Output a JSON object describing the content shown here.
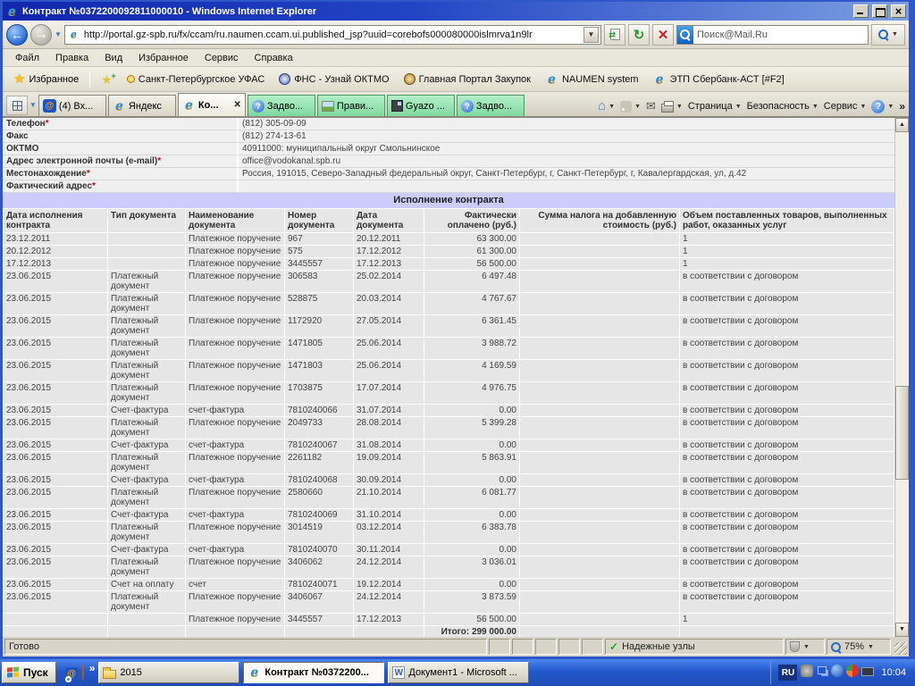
{
  "window": {
    "title": "Контракт №0372200092811000010 - Windows Internet Explorer"
  },
  "address_bar": {
    "url": "http://portal.gz-spb.ru/fx/ccam/ru.naumen.ccam.ui.published_jsp?uuid=corebofs000080000islmrva1n9lr",
    "search_text": "Поиск@Mail.Ru"
  },
  "menu_bar": {
    "items": [
      "Файл",
      "Правка",
      "Вид",
      "Избранное",
      "Сервис",
      "Справка"
    ]
  },
  "favorites_bar": {
    "favorites_label": "Избранное",
    "links": [
      {
        "label": "Санкт-Петербургское УФАС",
        "icon": "lamp-icon"
      },
      {
        "label": "ФНС - Узнай ОКТМО",
        "icon": "fns-emblem-icon"
      },
      {
        "label": "Главная Портал Закупок",
        "icon": "eagle-emblem-icon"
      },
      {
        "label": "NAUMEN system",
        "icon": "ie-icon"
      },
      {
        "label": "ЭТП Сбербанк-АСТ [#F2]",
        "icon": "ie-icon"
      }
    ]
  },
  "tab_bar": {
    "tabs": [
      {
        "label": "(4) Вх...",
        "icon": "mailru-icon",
        "style": "normal",
        "closable": false
      },
      {
        "label": "Яндекс",
        "icon": "ie-icon",
        "style": "normal",
        "closable": false
      },
      {
        "label": "Ко...",
        "icon": "ie-icon",
        "style": "active",
        "closable": true
      },
      {
        "label": "Задво...",
        "icon": "question-icon",
        "style": "green",
        "closable": false
      },
      {
        "label": "Прави...",
        "icon": "picture-icon",
        "style": "green",
        "closable": false
      },
      {
        "label": "Gyazo ...",
        "icon": "gyazo-icon",
        "style": "green",
        "closable": false
      },
      {
        "label": "Задво...",
        "icon": "question-icon",
        "style": "green",
        "closable": false
      }
    ],
    "commands": [
      "Страница",
      "Безопасность",
      "Сервис"
    ]
  },
  "page": {
    "form_rows": [
      {
        "label": "Телефон",
        "required": true,
        "value": "(812) 305-09-09"
      },
      {
        "label": "Факс",
        "required": false,
        "value": "(812) 274-13-61"
      },
      {
        "label": "ОКТМО",
        "required": false,
        "value": "40911000: муниципальный округ Смольнинское"
      },
      {
        "label": "Адрес электронной почты (e-mail)",
        "required": true,
        "value": "office@vodokanal.spb.ru"
      },
      {
        "label": "Местонахождение",
        "required": true,
        "value": "Россия, 191015, Северо-Западный федеральный округ, Санкт-Петербург, г, Санкт-Петербург, г, Кавалергардская, ул, д.42"
      },
      {
        "label": "Фактический адрес",
        "required": true,
        "value": ""
      }
    ],
    "section_title": "Исполнение контракта",
    "table": {
      "headers": [
        "Дата исполнения контракта",
        "Тип документа",
        "Наименование документа",
        "Номер документа",
        "Дата документа",
        "Фактически оплачено (руб.)",
        "Сумма налога на добавленную стоимость (руб.)",
        "Объем поставленных товаров, выполненных работ, оказанных услуг"
      ],
      "rows": [
        [
          "23.12.2011",
          "",
          "Платежное поручение",
          "967",
          "20.12.2011",
          "63 300.00",
          "",
          "1"
        ],
        [
          "20.12.2012",
          "",
          "Платежное поручение",
          "575",
          "17.12.2012",
          "61 300.00",
          "",
          "1"
        ],
        [
          "17.12.2013",
          "",
          "Платежное поручение",
          "3445557",
          "17.12.2013",
          "56 500.00",
          "",
          "1"
        ],
        [
          "23.06.2015",
          "Платежный документ",
          "Платежное поручение",
          "306583",
          "25.02.2014",
          "6 497.48",
          "",
          "в соответствии с договором"
        ],
        [
          "23.06.2015",
          "Платежный документ",
          "Платежное поручение",
          "528875",
          "20.03.2014",
          "4 767.67",
          "",
          "в соответствии с договором"
        ],
        [
          "23.06.2015",
          "Платежный документ",
          "Платежное поручение",
          "1172920",
          "27.05.2014",
          "6 361.45",
          "",
          "в соответствии с договором"
        ],
        [
          "23.06.2015",
          "Платежный документ",
          "Платежное поручение",
          "1471805",
          "25.06.2014",
          "3 988.72",
          "",
          "в соответствии с договором"
        ],
        [
          "23.06.2015",
          "Платежный документ",
          "Платежное поручение",
          "1471803",
          "25.06.2014",
          "4 169.59",
          "",
          "в соответствии с договором"
        ],
        [
          "23.06.2015",
          "Платежный документ",
          "Платежное поручение",
          "1703875",
          "17.07.2014",
          "4 976.75",
          "",
          "в соответствии с договором"
        ],
        [
          "23.06.2015",
          "Счет-фактура",
          "счет-фактура",
          "7810240066",
          "31.07.2014",
          "0.00",
          "",
          "в соответствии с договором"
        ],
        [
          "23.06.2015",
          "Платежный документ",
          "Платежное поручение",
          "2049733",
          "28.08.2014",
          "5 399.28",
          "",
          "в соответствии с договором"
        ],
        [
          "23.06.2015",
          "Счет-фактура",
          "счет-фактура",
          "7810240067",
          "31.08.2014",
          "0.00",
          "",
          "в соответствии с договором"
        ],
        [
          "23.06.2015",
          "Платежный документ",
          "Платежное поручение",
          "2261182",
          "19.09.2014",
          "5 863.91",
          "",
          "в соответствии с договором"
        ],
        [
          "23.06.2015",
          "Счет-фактура",
          "счет-фактура",
          "7810240068",
          "30.09.2014",
          "0.00",
          "",
          "в соответствии с договором"
        ],
        [
          "23.06.2015",
          "Платежный документ",
          "Платежное поручение",
          "2580660",
          "21.10.2014",
          "6 081.77",
          "",
          "в соответствии с договором"
        ],
        [
          "23.06.2015",
          "Счет-фактура",
          "счет-фактура",
          "7810240069",
          "31.10.2014",
          "0.00",
          "",
          "в соответствии с договором"
        ],
        [
          "23.06.2015",
          "Платежный документ",
          "Платежное поручение",
          "3014519",
          "03.12.2014",
          "6 383.78",
          "",
          "в соответствии с договором"
        ],
        [
          "23.06.2015",
          "Счет-фактура",
          "счет-фактура",
          "7810240070",
          "30.11.2014",
          "0.00",
          "",
          "в соответствии с договором"
        ],
        [
          "23.06.2015",
          "Платежный документ",
          "Платежное поручение",
          "3406062",
          "24.12.2014",
          "3 036.01",
          "",
          "в соответствии с договором"
        ],
        [
          "23.06.2015",
          "Счет на оплату",
          "счет",
          "7810240071",
          "19.12.2014",
          "0.00",
          "",
          "в соответствии с договором"
        ],
        [
          "23.06.2015",
          "Платежный документ",
          "Платежное поручение",
          "3406067",
          "24.12.2014",
          "3 873.59",
          "",
          "в соответствии с договором"
        ],
        [
          "",
          "",
          "Платежное поручение",
          "3445557",
          "17.12.2013",
          "56 500.00",
          "",
          "1"
        ]
      ],
      "total_label": "Итого:",
      "total_value": "299 000.00"
    }
  },
  "status_bar": {
    "status": "Готово",
    "zone_label": "Надежные узлы",
    "zoom_level": "75%"
  },
  "taskbar": {
    "start_label": "Пуск",
    "quick_launch": [
      "chrome-icon",
      "mailru-icon",
      "firefox-icon"
    ],
    "overflow_chevron": "»",
    "buttons": [
      {
        "label": "2015",
        "icon": "folder-icon",
        "active": false
      },
      {
        "label": "Контракт №0372200...",
        "icon": "ie-icon",
        "active": true
      },
      {
        "label": "Документ1 - Microsoft ...",
        "icon": "word-icon",
        "active": false
      }
    ],
    "tray_icons": [
      "gear-icon",
      "network-icon",
      "globe-icon",
      "antivirus-icon",
      "display-icon"
    ],
    "language_indicator": "RU",
    "clock": "10:04"
  }
}
